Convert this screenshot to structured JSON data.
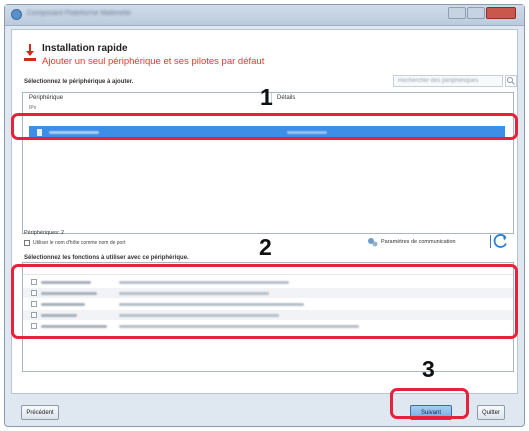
{
  "window": {
    "title": "Composant Plateforme Matérielle"
  },
  "header": {
    "title": "Installation rapide",
    "subtitle": "Ajouter un seul périphérique et ses pilotes par défaut"
  },
  "devices": {
    "section_label": "Sélectionnez le périphérique à ajouter.",
    "search_placeholder": "Rechercher des périphériques",
    "columns": {
      "device": "Périphérique",
      "details": "Détails"
    },
    "subheader": "IPv"
  },
  "periph_count": "Périphériques: 2",
  "option_label": "Utiliser le nom d'hôte comme nom de port",
  "comm_settings": "Paramètres de communication",
  "functions": {
    "section_label": "Sélectionnez les fonctions à utiliser avec ce périphérique."
  },
  "annotations": {
    "one": "1",
    "two": "2",
    "three": "3"
  },
  "buttons": {
    "previous": "Précédent",
    "next": "Suivant",
    "quit": "Quitter"
  },
  "colors": {
    "highlight": "#e5223a",
    "selection": "#3d8ee6",
    "accent_red": "#e23a2a"
  },
  "icons": [
    "app-icon",
    "install-arrow-icon",
    "search-icon",
    "network-settings-icon",
    "refresh-icon",
    "device-icon"
  ]
}
